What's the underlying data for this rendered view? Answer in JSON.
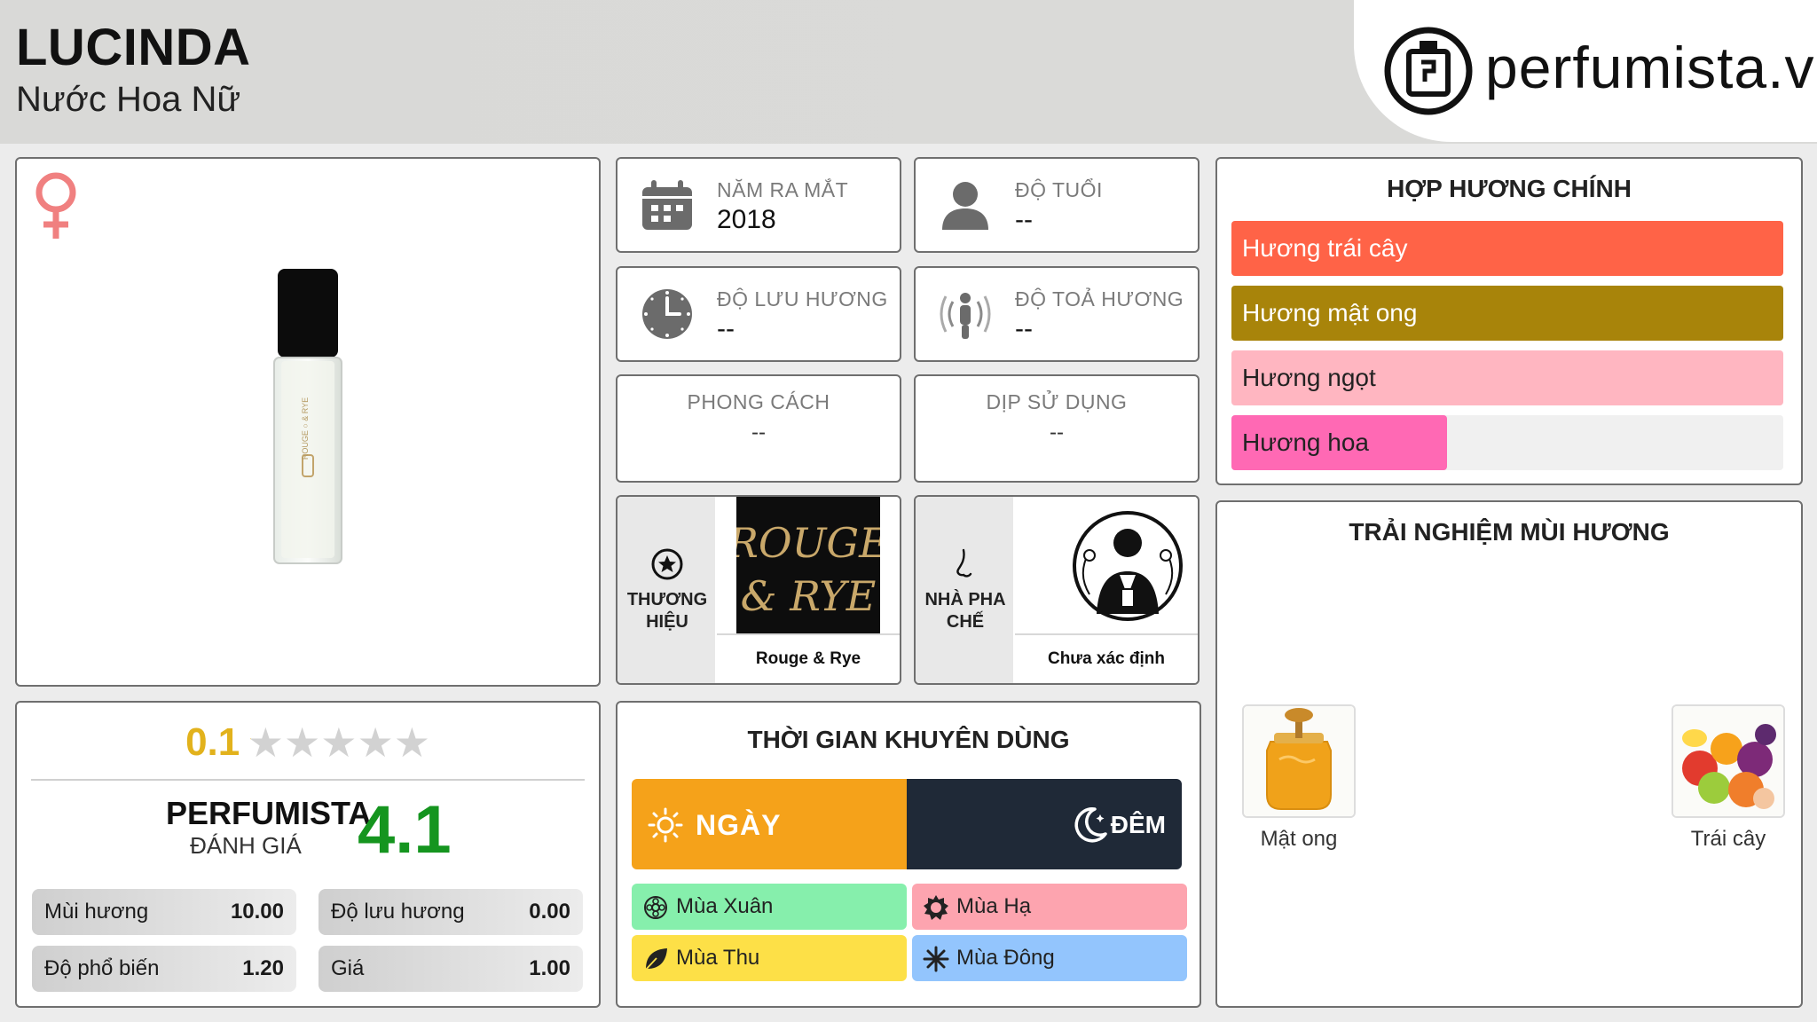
{
  "header": {
    "title": "LUCINDA",
    "subtitle": "Nước Hoa Nữ",
    "logo_text": "perfumista.vn"
  },
  "product": {
    "gender_icon": "female-symbol-icon",
    "image": "perfume-rollerball-bottle"
  },
  "rating": {
    "user_score": "0.1",
    "user_stars_filled": 0.1,
    "stars_total": 5,
    "perfumista_label": "PERFUMISTA",
    "perfumista_sub": "ĐÁNH GIÁ",
    "perfumista_score": "4.1",
    "metrics": [
      {
        "label": "Mùi hương",
        "value": "10.00"
      },
      {
        "label": "Độ lưu hương",
        "value": "0.00"
      },
      {
        "label": "Độ phổ biến",
        "value": "1.20"
      },
      {
        "label": "Giá",
        "value": "1.00"
      }
    ]
  },
  "info": {
    "release": {
      "label": "NĂM RA MẮT",
      "value": "2018",
      "icon": "calendar-icon"
    },
    "age": {
      "label": "ĐỘ TUỔI",
      "value": "--",
      "icon": "person-icon"
    },
    "longevity": {
      "label": "ĐỘ LƯU HƯƠNG",
      "value": "--",
      "icon": "clock-icon"
    },
    "sillage": {
      "label": "ĐỘ TOẢ HƯƠNG",
      "value": "--",
      "icon": "sillage-person-icon"
    },
    "style": {
      "label": "PHONG CÁCH",
      "value": "--"
    },
    "occasion": {
      "label": "DỊP SỬ DỤNG",
      "value": "--"
    }
  },
  "brand": {
    "label_line1": "THƯƠNG",
    "label_line2": "HIỆU",
    "logo_line1": "ROUGE",
    "logo_line2": "& RYE",
    "name": "Rouge & Rye"
  },
  "perfumer": {
    "label_line1": "NHÀ PHA",
    "label_line2": "CHẾ",
    "name": "Chưa xác định"
  },
  "time": {
    "title": "THỜI GIAN KHUYÊN DÙNG",
    "day_label": "NGÀY",
    "night_label": "ĐÊM",
    "seasons": {
      "spring": {
        "label": "Mùa Xuân",
        "color": "#86efac"
      },
      "summer": {
        "label": "Mùa Hạ",
        "color": "#fda4af"
      },
      "autumn": {
        "label": "Mùa Thu",
        "color": "#fde047"
      },
      "winter": {
        "label": "Mùa Đông",
        "color": "#93c5fd"
      }
    }
  },
  "accords": {
    "title": "HỢP HƯƠNG CHÍNH",
    "items": [
      {
        "label": "Hương trái cây",
        "color": "#ff6347",
        "percent": 100
      },
      {
        "label": "Hương mật ong",
        "color": "#a8840a",
        "percent": 100
      },
      {
        "label": "Hương ngọt",
        "color": "#ffb6c1",
        "percent": 100
      },
      {
        "label": "Hương hoa",
        "color": "#ff69b4",
        "percent": 39
      }
    ]
  },
  "experience": {
    "title": "TRẢI NGHIỆM MÙI HƯƠNG",
    "items": [
      {
        "label": "Mật ong",
        "icon": "honey-jar-icon"
      },
      {
        "label": "Trái cây",
        "icon": "fruit-basket-icon"
      }
    ]
  }
}
